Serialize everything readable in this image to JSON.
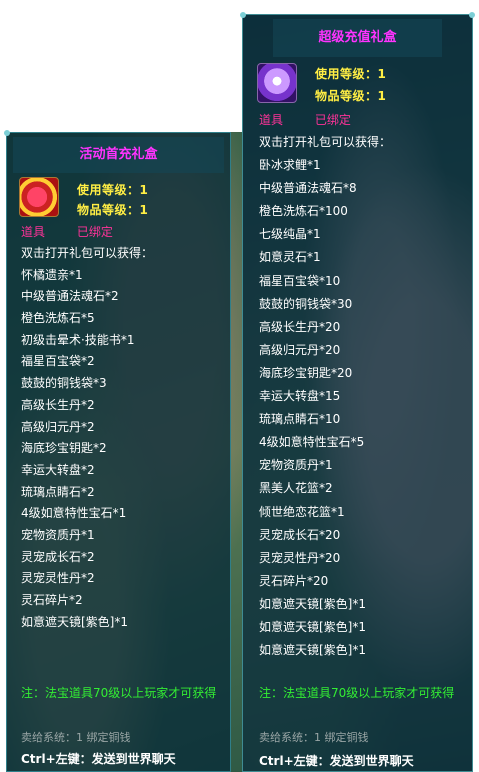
{
  "left_tooltip": {
    "title": "活动首充礼盒",
    "use_level": "使用等级：1",
    "item_level": "物品等级：1",
    "tag_type": "道具",
    "tag_bound": "已绑定",
    "intro": "双击打开礼包可以获得：",
    "items": [
      "怀橘遗亲*1",
      "中级普通法魂石*2",
      "橙色洗炼石*5",
      "初级击晕术·技能书*1",
      "福星百宝袋*2",
      "鼓鼓的铜钱袋*3",
      "高级长生丹*2",
      "高级归元丹*2",
      "海底珍宝钥匙*2",
      "幸运大转盘*2",
      "琉璃点睛石*2",
      "4级如意特性宝石*1",
      "宠物资质丹*1",
      "灵宠成长石*2",
      "灵宠灵性丹*2",
      "灵石碎片*2",
      "如意遮天镜[紫色]*1"
    ],
    "note": "注：法宝道具70级以上玩家才可获得",
    "bind_info": "卖给系统：1 绑定铜钱",
    "ctrl_hint": "Ctrl+左键：发送到世界聊天"
  },
  "right_tooltip": {
    "title": "超级充值礼盒",
    "use_level": "使用等级：1",
    "item_level": "物品等级：1",
    "tag_type": "道具",
    "tag_bound": "已绑定",
    "intro": "双击打开礼包可以获得：",
    "items": [
      "卧冰求鲤*1",
      "中级普通法魂石*8",
      "橙色洗炼石*100",
      "七级纯晶*1",
      "如意灵石*1",
      "福星百宝袋*10",
      "鼓鼓的铜钱袋*30",
      "高级长生丹*20",
      "高级归元丹*20",
      "海底珍宝钥匙*20",
      "幸运大转盘*15",
      "琉璃点睛石*10",
      "4级如意特性宝石*5",
      "宠物资质丹*1",
      "黑美人花篮*2",
      "倾世绝恋花篮*1",
      "灵宠成长石*20",
      "灵宠灵性丹*20",
      "灵石碎片*20",
      "如意遮天镜[紫色]*1",
      "如意遮天镜[紫色]*1",
      "如意遮天镜[紫色]*1"
    ],
    "note": "注：法宝道具70级以上玩家才可获得",
    "bind_info": "卖给系统：1 绑定铜钱",
    "ctrl_hint": "Ctrl+左键：发送到世界聊天"
  },
  "colors": {
    "title": "#ff33ff",
    "level": "#ffee44",
    "tag": "#ff3399",
    "note": "#33ee33",
    "panel_border": "#2f7f8a"
  },
  "icons": {
    "left_item": "red-gift-box-icon",
    "right_item": "purple-gift-box-icon"
  }
}
